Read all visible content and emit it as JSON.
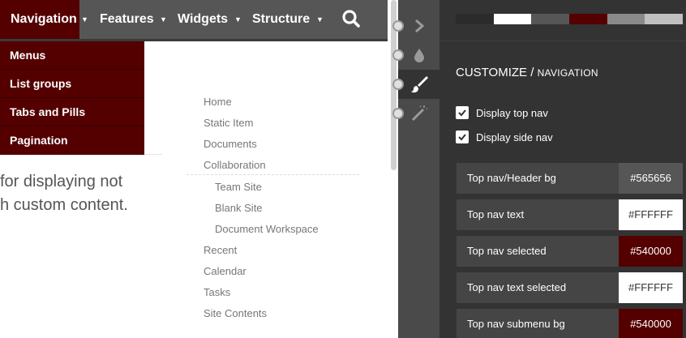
{
  "topnav": {
    "items": [
      {
        "label": "Navigation",
        "selected": true
      },
      {
        "label": "Features",
        "selected": false
      },
      {
        "label": "Widgets",
        "selected": false
      },
      {
        "label": "Structure",
        "selected": false
      }
    ],
    "caret_icon": "caret-down-icon",
    "search_icon": "search-icon"
  },
  "submenu": {
    "items": [
      "Menus",
      "List groups",
      "Tabs and Pills",
      "Pagination"
    ]
  },
  "body": {
    "line1": "for displaying not",
    "line2": "h custom content."
  },
  "sidenav": {
    "items": [
      "Home",
      "Static Item",
      "Documents",
      "Collaboration",
      "Team Site",
      "Blank Site",
      "Document Workspace",
      "Recent",
      "Calendar",
      "Tasks",
      "Site Contents"
    ]
  },
  "tools": [
    {
      "icon": "chevron-right-icon",
      "active": false
    },
    {
      "icon": "droplet-icon",
      "active": false
    },
    {
      "icon": "paintbrush-icon",
      "active": true
    },
    {
      "icon": "magic-wand-icon",
      "active": false
    }
  ],
  "panel": {
    "swatches": [
      "#2b2b2b",
      "#ffffff",
      "#565656",
      "#540000",
      "#8a8a8a",
      "#c0c0c0"
    ],
    "title_main": "CUSTOMIZE",
    "title_sep": " / ",
    "title_sub": "NAVIGATION",
    "options": [
      {
        "label": "Display top nav",
        "checked": true
      },
      {
        "label": "Display side nav",
        "checked": true
      }
    ],
    "colors": [
      {
        "label": "Top nav/Header bg",
        "value": "#565656",
        "swatch": "#565656",
        "text_color": "#ffffff"
      },
      {
        "label": "Top nav text",
        "value": "#FFFFFF",
        "swatch": "#ffffff",
        "text_color": "#333333"
      },
      {
        "label": "Top nav selected",
        "value": "#540000",
        "swatch": "#540000",
        "text_color": "#ffffff"
      },
      {
        "label": "Top nav text selected",
        "value": "#FFFFFF",
        "swatch": "#ffffff",
        "text_color": "#333333"
      },
      {
        "label": "Top nav submenu bg",
        "value": "#540000",
        "swatch": "#540000",
        "text_color": "#ffffff"
      }
    ]
  }
}
